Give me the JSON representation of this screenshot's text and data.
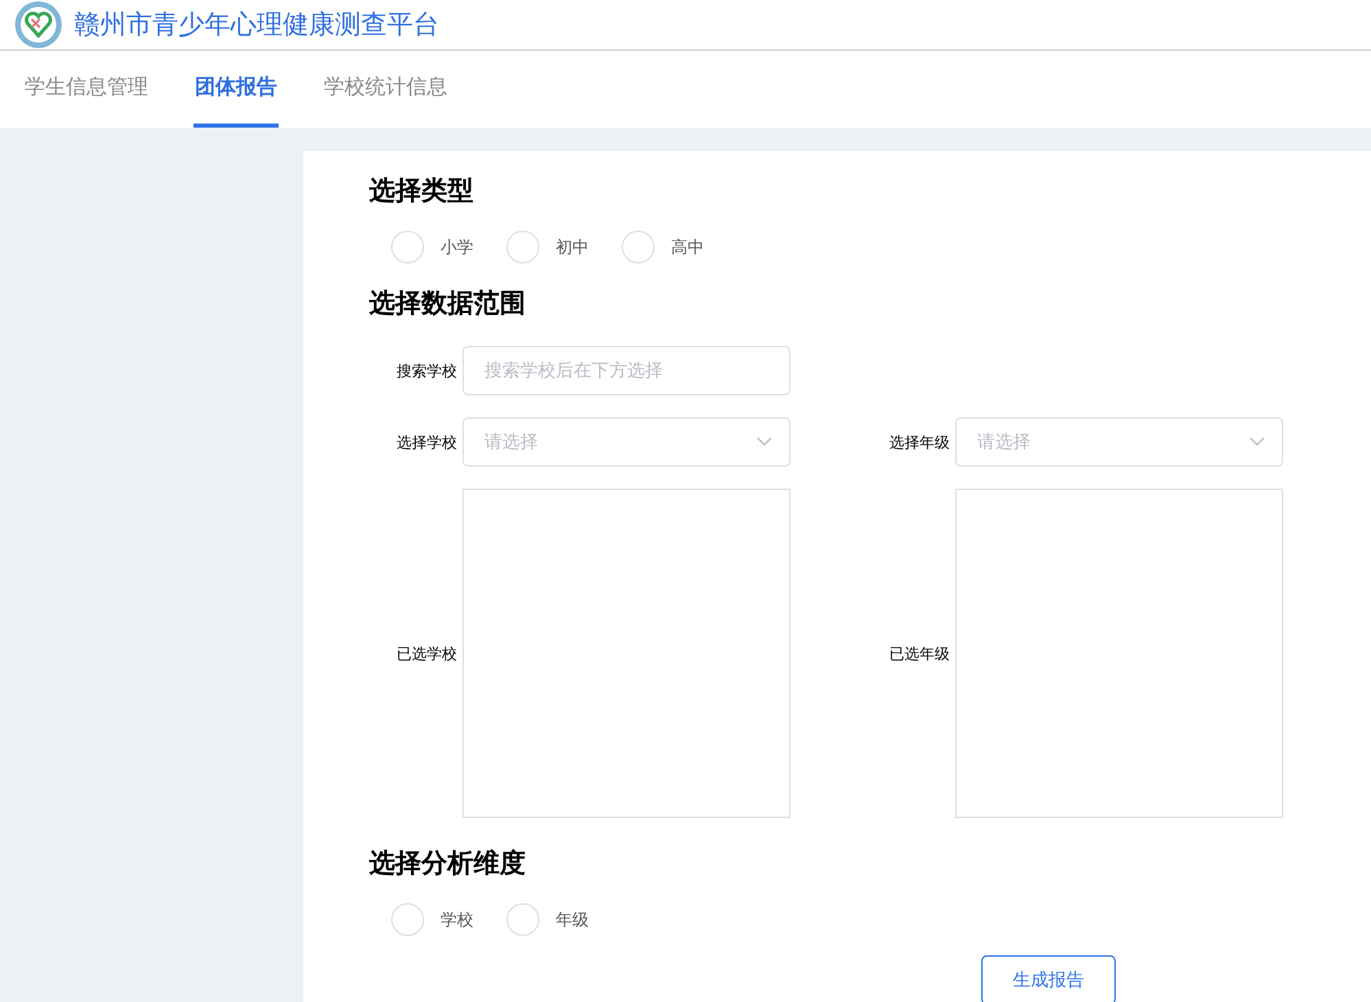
{
  "header": {
    "title": "赣州市青少年心理健康测查平台"
  },
  "tabs": [
    {
      "label": "学生信息管理",
      "selected": false
    },
    {
      "label": "团体报告",
      "selected": true
    },
    {
      "label": "学校统计信息",
      "selected": false
    }
  ],
  "type_section": {
    "heading": "选择类型",
    "options": [
      {
        "label": "小学",
        "selected": false
      },
      {
        "label": "初中",
        "selected": false
      },
      {
        "label": "高中",
        "selected": false
      }
    ]
  },
  "range_section": {
    "heading": "选择数据范围",
    "search": {
      "label": "搜索学校",
      "placeholder": "搜索学校后在下方选择"
    },
    "school_select": {
      "label": "选择学校",
      "placeholder": "请选择"
    },
    "grade_select": {
      "label": "选择年级",
      "placeholder": "请选择"
    },
    "selected_schools": {
      "label": "已选学校"
    },
    "selected_grades": {
      "label": "已选年级"
    }
  },
  "dimension_section": {
    "heading": "选择分析维度",
    "options": [
      {
        "label": "学校",
        "selected": false
      },
      {
        "label": "年级",
        "selected": false
      }
    ]
  },
  "generate_button": "生成报告"
}
